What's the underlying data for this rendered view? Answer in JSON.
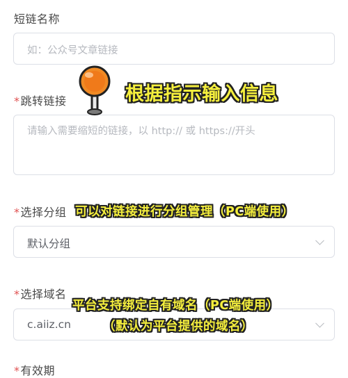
{
  "form": {
    "short_name": {
      "label": "短链名称",
      "required": false,
      "placeholder": "如：公众号文章链接"
    },
    "jump_link": {
      "label": "跳转链接",
      "required": true,
      "placeholder": "请输入需要缩短的链接，以 http:// 或 https://开头"
    },
    "group": {
      "label": "选择分组",
      "required": true,
      "value": "默认分组"
    },
    "domain": {
      "label": "选择域名",
      "required": true,
      "value": "c.aiiz.cn"
    },
    "validity": {
      "label": "有效期",
      "required": true
    }
  },
  "annotations": {
    "tip_input": "根据指示输入信息",
    "tip_group": "可以对链接进行分组管理（PC端使用）",
    "tip_domain_1": "平台支持绑定自有域名（PC端使用）",
    "tip_domain_2": "（默认为平台提供的域名）"
  },
  "colors": {
    "required_mark": "#e05252",
    "annotation_text": "#f5ef3d",
    "pin_head": "#f08a24"
  },
  "icons": {
    "pin": "pushpin-icon",
    "select_arrow": "chevron-down-icon"
  }
}
